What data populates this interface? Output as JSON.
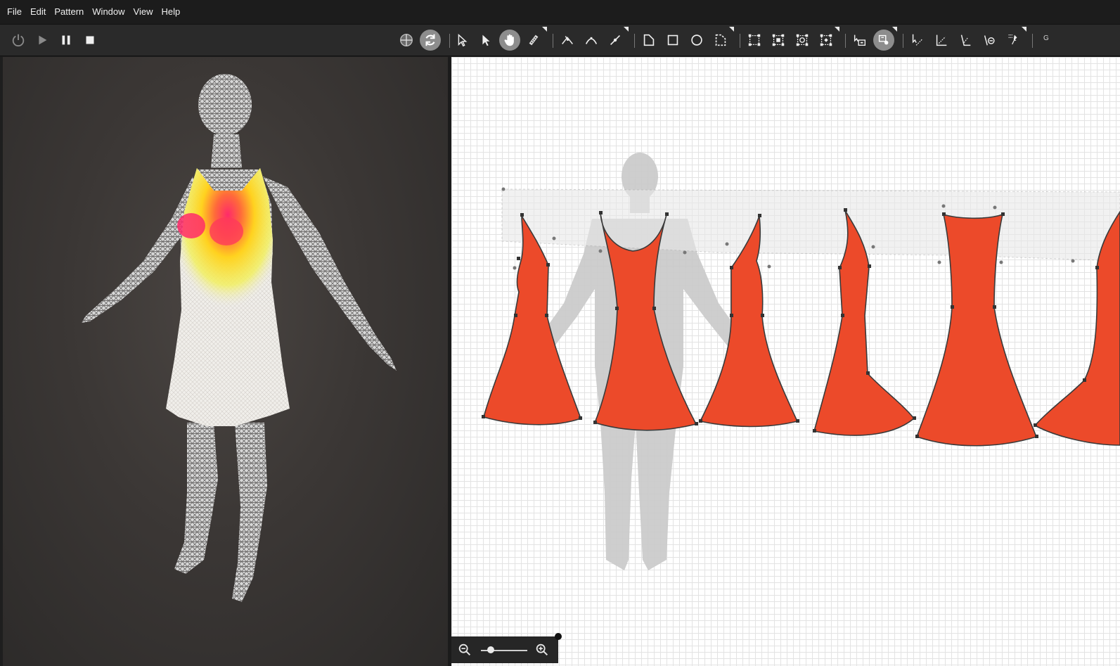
{
  "menu": {
    "items": [
      "File",
      "Edit",
      "Pattern",
      "Window",
      "View",
      "Help"
    ]
  },
  "toolbar": {
    "playback": [
      "power-icon",
      "play-icon",
      "pause-icon",
      "stop-icon"
    ],
    "tail_label": "G"
  },
  "pattern_window": {
    "piece_color": "#ec4a2a",
    "piece_outline": "#3a3a3a",
    "avatar_color": "#c9c9c9"
  },
  "viewport": {
    "heatmap_colors": [
      "#ff2a6a",
      "#ff7a2a",
      "#ffd21f",
      "#f7f24a"
    ]
  }
}
